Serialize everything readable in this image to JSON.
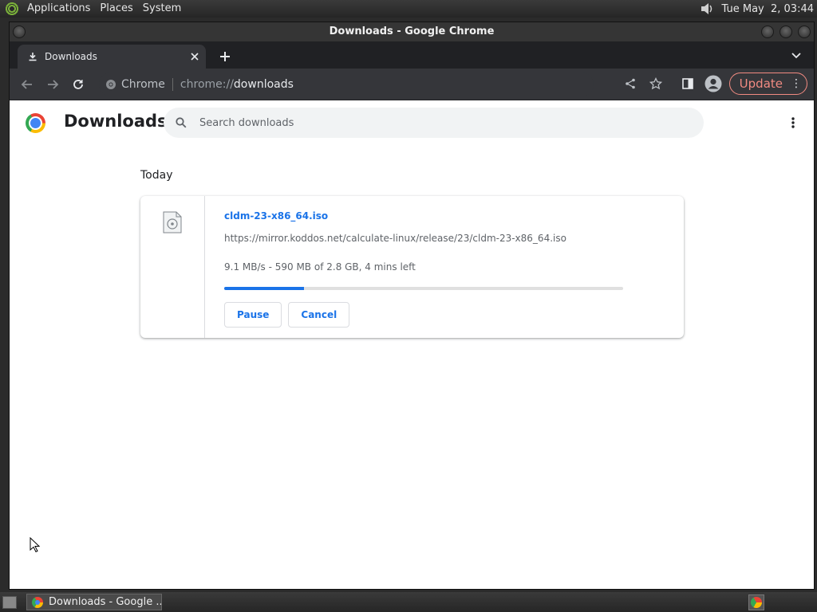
{
  "top_panel": {
    "menus": [
      "Applications",
      "Places",
      "System"
    ],
    "clock": "Tue May  2, 03:44"
  },
  "window": {
    "title": "Downloads - Google Chrome"
  },
  "tab": {
    "title": "Downloads",
    "icon": "download-icon"
  },
  "omnibox": {
    "chip_label": "Chrome",
    "url_scheme": "chrome://",
    "url_host": "downloads"
  },
  "toolbar": {
    "update_label": "Update"
  },
  "page": {
    "title": "Downloads",
    "search_placeholder": "Search downloads",
    "date_heading": "Today"
  },
  "download": {
    "file_name": "cldm-23-x86_64.iso",
    "url": "https://mirror.koddos.net/calculate-linux/release/23/cldm-23-x86_64.iso",
    "status": "9.1 MB/s - 590 MB of 2.8 GB, 4 mins left",
    "progress_fraction": 0.2,
    "pause_label": "Pause",
    "cancel_label": "Cancel"
  },
  "taskbar": {
    "task_label": "Downloads - Google ..."
  },
  "colors": {
    "accent": "#1a73e8",
    "update": "#f28b82"
  }
}
